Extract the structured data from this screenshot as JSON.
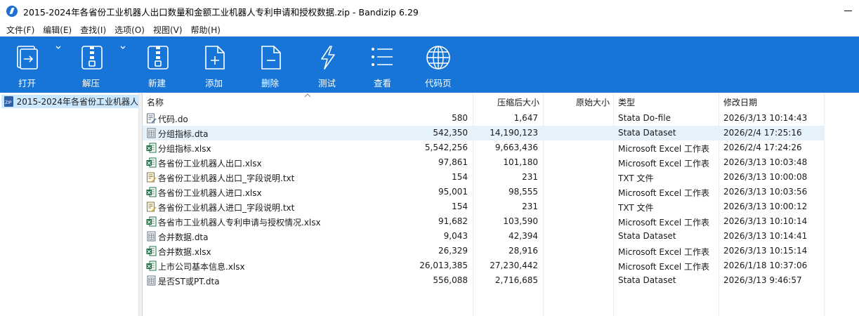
{
  "window": {
    "title": "2015-2024年各省份工业机器人出口数量和金额工业机器人专利申请和授权数据.zip - Bandizip 6.29"
  },
  "menu": [
    "文件(F)",
    "编辑(E)",
    "查找(I)",
    "选项(O)",
    "视图(V)",
    "帮助(H)"
  ],
  "toolbar": {
    "open": "打开",
    "extract": "解压",
    "new": "新建",
    "add": "添加",
    "delete": "删除",
    "test": "测试",
    "view": "查看",
    "codepage": "代码页"
  },
  "tree": {
    "root": "2015-2024年各省份工业机器人"
  },
  "columns": {
    "name": "名称",
    "compressed": "压缩后大小",
    "original": "原始大小",
    "type": "类型",
    "modified": "修改日期"
  },
  "files": [
    {
      "name": "代码.do",
      "compressed": "580",
      "original": "1,647",
      "type": "Stata Do-file",
      "modified": "2026/3/13 10:14:43",
      "icon": "do-file-icon"
    },
    {
      "name": "分组指标.dta",
      "compressed": "542,350",
      "original": "14,190,123",
      "type": "Stata Dataset",
      "modified": "2026/2/4 17:25:16",
      "icon": "dta-file-icon"
    },
    {
      "name": "分组指标.xlsx",
      "compressed": "5,542,256",
      "original": "9,663,436",
      "type": "Microsoft Excel 工作表",
      "modified": "2026/2/4 17:24:26",
      "icon": "excel-file-icon"
    },
    {
      "name": "各省份工业机器人出口.xlsx",
      "compressed": "97,861",
      "original": "101,180",
      "type": "Microsoft Excel 工作表",
      "modified": "2026/3/13 10:03:48",
      "icon": "excel-file-icon"
    },
    {
      "name": "各省份工业机器人出口_字段说明.txt",
      "compressed": "154",
      "original": "231",
      "type": "TXT 文件",
      "modified": "2026/3/13 10:00:08",
      "icon": "txt-file-icon"
    },
    {
      "name": "各省份工业机器人进口.xlsx",
      "compressed": "95,001",
      "original": "98,555",
      "type": "Microsoft Excel 工作表",
      "modified": "2026/3/13 10:03:56",
      "icon": "excel-file-icon"
    },
    {
      "name": "各省份工业机器人进口_字段说明.txt",
      "compressed": "154",
      "original": "231",
      "type": "TXT 文件",
      "modified": "2026/3/13 10:00:12",
      "icon": "txt-file-icon"
    },
    {
      "name": "各省市工业机器人专利申请与授权情况.xlsx",
      "compressed": "91,682",
      "original": "103,590",
      "type": "Microsoft Excel 工作表",
      "modified": "2026/3/13 10:10:14",
      "icon": "excel-file-icon"
    },
    {
      "name": "合并数据.dta",
      "compressed": "9,043",
      "original": "42,394",
      "type": "Stata Dataset",
      "modified": "2026/3/13 10:14:41",
      "icon": "dta-file-icon"
    },
    {
      "name": "合并数据.xlsx",
      "compressed": "26,329",
      "original": "28,916",
      "type": "Microsoft Excel 工作表",
      "modified": "2026/3/13 10:15:14",
      "icon": "excel-file-icon"
    },
    {
      "name": "上市公司基本信息.xlsx",
      "compressed": "26,013,385",
      "original": "27,230,442",
      "type": "Microsoft Excel 工作表",
      "modified": "2026/1/18 10:37:06",
      "icon": "excel-file-icon"
    },
    {
      "name": "是否ST或PT.dta",
      "compressed": "556,088",
      "original": "2,716,685",
      "type": "Stata Dataset",
      "modified": "2026/3/13 9:46:57",
      "icon": "dta-file-icon"
    }
  ],
  "colors": {
    "toolbar_bg": "#1675d6",
    "selection_bg": "#e5f1fb",
    "tree_selection_bg": "#cce8ff"
  }
}
